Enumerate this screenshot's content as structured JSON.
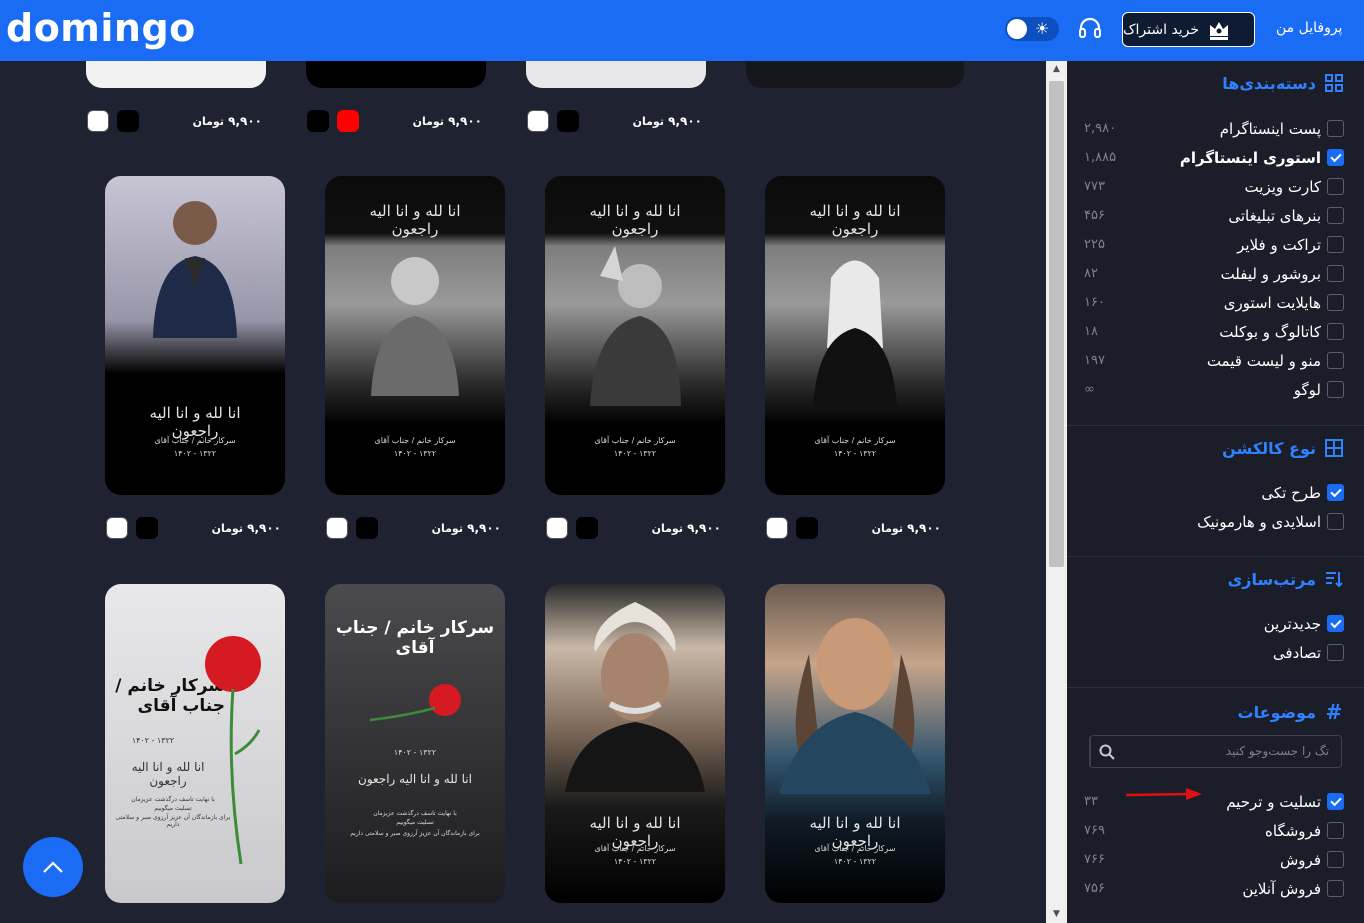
{
  "header": {
    "logo": "domingo",
    "profile": "پروفایل من",
    "subscribe": "خرید اشتراک"
  },
  "currency": "تومان",
  "top_prices": [
    {
      "price": "۹,۹۰۰",
      "currency": "تومان"
    },
    {
      "price": "۹,۹۰۰",
      "currency": "تومان"
    },
    {
      "price": "۹,۹۰۰",
      "currency": "تومان"
    }
  ],
  "row1": [
    {
      "price": "۹,۹۰۰",
      "currency": "تومان",
      "script": "انا لله و انا الیه راجعون",
      "name": "سرکار خانم / جناب آقای",
      "years": "۱۴۰۲ - ۱۳۲۲"
    },
    {
      "price": "۹,۹۰۰",
      "currency": "تومان",
      "script": "انا لله و انا الیه راجعون",
      "name": "سرکار خانم / جناب آقای",
      "years": "۱۴۰۲ - ۱۳۲۲"
    },
    {
      "price": "۹,۹۰۰",
      "currency": "تومان",
      "script": "انا لله و انا الیه راجعون",
      "name": "سرکار خانم / جناب آقای",
      "years": "۱۴۰۲ - ۱۳۲۲"
    },
    {
      "price": "۹,۹۰۰",
      "currency": "تومان",
      "script": "انا لله و انا الیه راجعون",
      "name": "سرکار خانم / جناب آقای",
      "years": "۱۴۰۲ - ۱۳۲۲"
    }
  ],
  "row2": [
    {
      "head": "سرکار خانم / جناب آقای",
      "years": "۱۴۰۲ - ۱۳۲۲",
      "script": "انا لله و انا الیه راجعون",
      "line1": "با نهایت تاسف درگذشت عزیزمان",
      "line2": "تسلیت میگوییم",
      "line3": "برای بازماندگان آن عزیز آرزوی صبر و سلامتی داریم"
    },
    {
      "head": "سرکار خانم / جناب آقای",
      "years": "۱۴۰۲ - ۱۳۲۲",
      "script": "انا لله و انا الیه راجعون",
      "line1": "با نهایت تاسف درگذشت عزیزمان",
      "line2": "تسلیت میگوییم",
      "line3": "برای بازماندگان آن عزیز آرزوی صبر و سلامتی داریم"
    },
    {
      "script": "انا لله و انا الیه راجعون",
      "name": "سرکار خانم / جناب آقای",
      "years": "۱۴۰۲ - ۱۳۲۲"
    },
    {
      "script": "انا لله و انا الیه راجعون",
      "name": "سرکار خانم / جناب آقای",
      "years": "۱۴۰۲ - ۱۳۲۲"
    }
  ],
  "categories": {
    "title": "دسته‌بندی‌ها",
    "items": [
      {
        "label": "پست اینستاگرام",
        "count": "۲,۹۸۰",
        "checked": false
      },
      {
        "label": "استوری اینستاگرام",
        "count": "۱,۸۸۵",
        "checked": true
      },
      {
        "label": "کارت ویزیت",
        "count": "۷۷۳",
        "checked": false
      },
      {
        "label": "بنرهای تبلیغاتی",
        "count": "۴۵۶",
        "checked": false
      },
      {
        "label": "تراکت و فلایر",
        "count": "۲۲۵",
        "checked": false
      },
      {
        "label": "بروشور و لیفلت",
        "count": "۸۲",
        "checked": false
      },
      {
        "label": "هایلایت استوری",
        "count": "۱۶۰",
        "checked": false
      },
      {
        "label": "کاتالوگ و بوکلت",
        "count": "۱۸",
        "checked": false
      },
      {
        "label": "منو و لیست قیمت",
        "count": "۱۹۷",
        "checked": false
      },
      {
        "label": "لوگو",
        "count": "∞",
        "checked": false
      }
    ]
  },
  "collection": {
    "title": "نوع کالکشن",
    "items": [
      {
        "label": "طرح تکی",
        "checked": true
      },
      {
        "label": "اسلایدی و هارمونیک",
        "checked": false
      }
    ]
  },
  "sort": {
    "title": "مرتب‌سازی",
    "items": [
      {
        "label": "جدیدترین",
        "checked": true
      },
      {
        "label": "تصادفی",
        "checked": false
      }
    ]
  },
  "topics": {
    "title": "موضوعات",
    "search_placeholder": "تگ را جست‌وجو کنید",
    "items": [
      {
        "label": "تسلیت و ترحیم",
        "count": "۳۳",
        "checked": true
      },
      {
        "label": "فروشگاه",
        "count": "۷۶۹",
        "checked": false
      },
      {
        "label": "فروش",
        "count": "۷۶۶",
        "checked": false
      },
      {
        "label": "فروش آنلاین",
        "count": "۷۵۶",
        "checked": false
      }
    ]
  },
  "colors": {
    "accent": "#1a6cf5",
    "link": "#2e82ff",
    "sidebar_bg": "#1b1d29",
    "content_bg": "#1f2230"
  }
}
